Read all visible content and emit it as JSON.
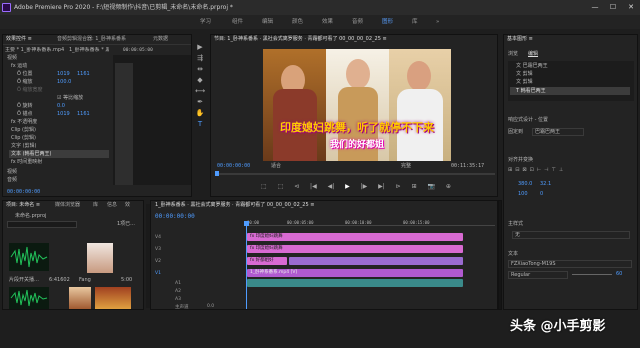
{
  "window": {
    "title": "Adobe Premiere Pro 2020 - F:\\短视频制作\\抖音\\已剪辑_未命名\\未命名.prproj *",
    "controls": [
      "—",
      "☐",
      "✕"
    ]
  },
  "menu": {
    "items": [
      "学习",
      "组件",
      "编辑",
      "颜色",
      "效果",
      "音频",
      "图形",
      "库",
      "»"
    ],
    "active_index": 6
  },
  "effect_controls": {
    "tabs": [
      "效果控件 ≡",
      "音频剪辑混合器: 1_卧神系番系",
      "元数据"
    ],
    "source_label": "主要 * 1_卧神系番系.mp4",
    "seq_label": "1_卧神系番系 * 黑社会式离罗服务 …",
    "timecode": "00:00:05:00",
    "sections": [
      "视频",
      "fx 运动",
      "Ö 位置",
      "Ö 缩放",
      "Ö 缩放宽度",
      "☑ 等比缩放",
      "Ö 旋转",
      "Ö 锚点",
      "fx 不透明度",
      "Clip (剪辑)",
      "Clip (剪辑)",
      "文字 (剪辑)",
      "文本 (韩看巴两王)",
      "fx 时间重映射",
      "视频",
      "音频"
    ],
    "values": {
      "position_x": "1019",
      "position_y": "1161",
      "scale": "100.0",
      "rotation": "0.0",
      "anchor_x": "1019",
      "anchor_y": "1161"
    },
    "mini_clip": "1_卧神…",
    "footer_timecode": "00:00:00:00"
  },
  "program": {
    "title": "节目: 1_卧神系番系 · 黑社会式离罗服务 · 青霜都可看了 00_00_00_02_25 ≡",
    "caption_line1": "印度媳妇跳舞，听了就停不下来",
    "caption_line2": "我们的好都姐",
    "timecode_left": "00:00:00:00",
    "fit": "适合",
    "quality": "完整",
    "timecode_right": "00:11:35:17",
    "transport": [
      "⬚",
      "⬚",
      "⊲",
      "|◀",
      "◀|",
      "▶",
      "|▶",
      "▶|",
      "⊳",
      "⊞",
      "📷",
      "⊕"
    ]
  },
  "project": {
    "tabs": [
      "项目: 未命名 ≡",
      "媒体浏览器",
      "库",
      "信息",
      "效"
    ],
    "file": "未命名.prproj",
    "count": "1项已...",
    "items": [
      {
        "name": "片段开关播…",
        "meta": "6:41602"
      },
      {
        "name": "Fang",
        "meta": "5:00"
      },
      {
        "name": "",
        "meta": ""
      },
      {
        "name": "",
        "meta": ""
      }
    ]
  },
  "timeline": {
    "title": "1_卧神系番系 · 黑社会式离罗服务 · 青霜都可看了 00_00_00_02_25 ≡",
    "timecode": "00:00:00:00",
    "ruler": [
      "00:00",
      "00:00:05:00",
      "00:00:10:00",
      "00:00:15:00"
    ],
    "tracks": [
      "V4",
      "V3",
      "V2",
      "V1",
      "A1",
      "A2",
      "A3",
      "主声道"
    ],
    "clip_labels": [
      "fx 印度媳妇跳舞",
      "fx 印度媳妇跳舞",
      "fx 好都姐好",
      "1_卧神系番系.mp4 [V]"
    ],
    "master_value": "0.0"
  },
  "essential": {
    "title": "基本图形 ≡",
    "tabs": [
      "浏览",
      "编辑"
    ],
    "layers": [
      "文 巴霜巴两王",
      "文 剪辑",
      "文 剪辑",
      "T 韩看巴两王"
    ],
    "align_label": "响应式设计 - 位置",
    "pin_label": "固定到",
    "pin_value": "巴霜巴两王",
    "align_section": "对齐并变换",
    "pos": "380.0",
    "pos2": "32.1",
    "size": "100",
    "rot": "0",
    "master_style_label": "主样式",
    "master_style": "无",
    "text_label": "文本",
    "font": "FZXiaoTong-M19S",
    "font_style": "Regular",
    "font_size": "60",
    "watermark": "头条 @小手剪影"
  },
  "colors": {
    "accent": "#4f9cff",
    "audio": "#1e8f3e",
    "pink": "#d86ad2",
    "caption": "#ffcc00"
  }
}
